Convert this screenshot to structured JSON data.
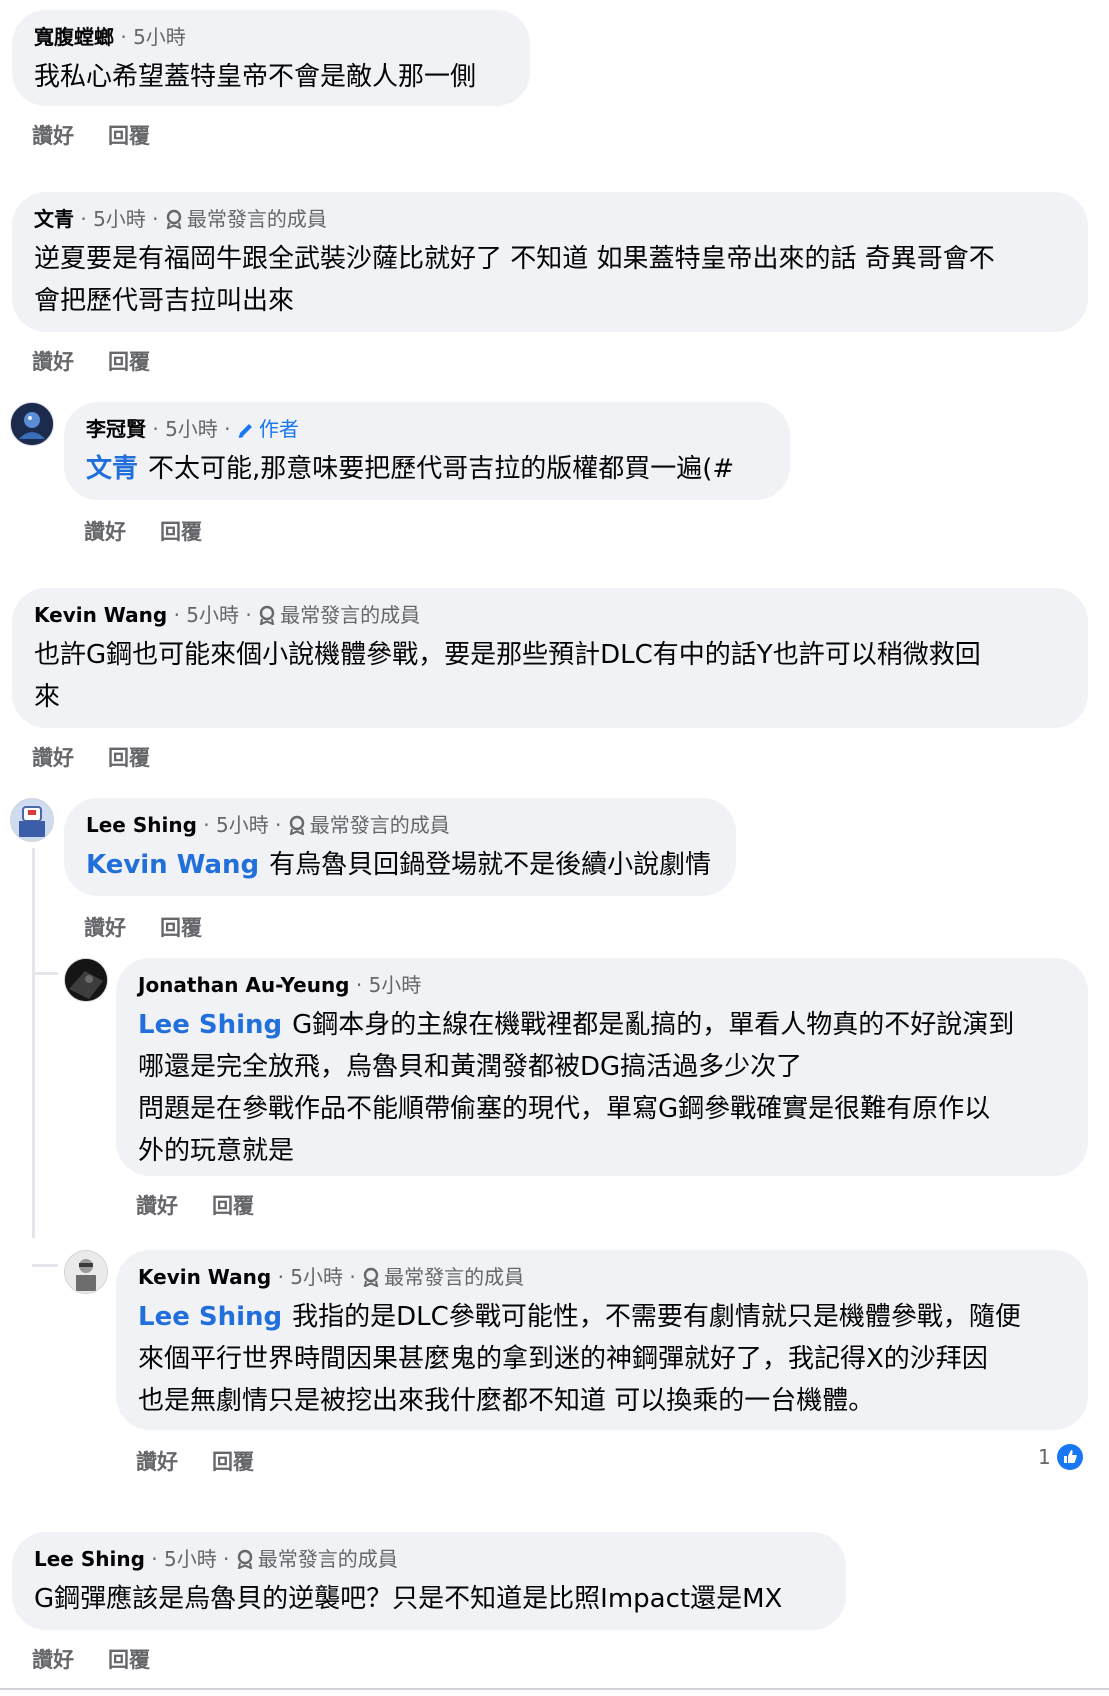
{
  "comments": [
    {
      "author": "寬腹螳螂",
      "time": "5小時",
      "badge": "",
      "mention": "",
      "text": "我私心希望蓋特皇帝不會是敵人那一側",
      "like": "讚好",
      "reply": "回覆"
    },
    {
      "author": "文青",
      "time": "5小時",
      "badge": "最常發言的成員",
      "mention": "",
      "text": "逆夏要是有福岡牛跟全武裝沙薩比就好了 不知道 如果蓋特皇帝出來的話 奇異哥會不\n會把歷代哥吉拉叫出來",
      "like": "讚好",
      "reply": "回覆"
    },
    {
      "author": "李冠賢",
      "time": "5小時",
      "badge": "作者",
      "mention": "文青",
      "text": "不太可能,那意味要把歷代哥吉拉的版權都買一遍(#",
      "like": "讚好",
      "reply": "回覆"
    },
    {
      "author": "Kevin Wang",
      "time": "5小時",
      "badge": "最常發言的成員",
      "mention": "",
      "text": "也許G鋼也可能來個小說機體參戰，要是那些預計DLC有中的話Y也許可以稍微救回\n來",
      "like": "讚好",
      "reply": "回覆"
    },
    {
      "author": "Lee Shing",
      "time": "5小時",
      "badge": "最常發言的成員",
      "mention": "Kevin Wang",
      "text": "有烏魯貝回鍋登場就不是後續小說劇情",
      "like": "讚好",
      "reply": "回覆"
    },
    {
      "author": "Jonathan Au-Yeung",
      "time": "5小時",
      "badge": "",
      "mention": "Lee Shing",
      "text": "G鋼本身的主線在機戰裡都是亂搞的，單看人物真的不好說演到\n哪還是完全放飛，烏魯貝和黃潤發都被DG搞活過多少次了\n問題是在參戰作品不能順帶偷塞的現代，單寫G鋼參戰確實是很難有原作以\n外的玩意就是",
      "like": "讚好",
      "reply": "回覆"
    },
    {
      "author": "Kevin Wang",
      "time": "5小時",
      "badge": "最常發言的成員",
      "mention": "Lee Shing",
      "text": "我指的是DLC參戰可能性，不需要有劇情就只是機體參戰，隨便\n來個平行世界時間因果甚麼鬼的拿到迷的神鋼彈就好了，我記得X的沙拜因\n也是無劇情只是被挖出來我什麼都不知道 可以換乘的一台機體。",
      "like": "讚好",
      "reply": "回覆",
      "reaction_count": "1"
    },
    {
      "author": "Lee Shing",
      "time": "5小時",
      "badge": "最常發言的成員",
      "mention": "",
      "text": "G鋼彈應該是烏魯貝的逆襲吧？只是不知道是比照Impact還是MX",
      "like": "讚好",
      "reply": "回覆"
    }
  ],
  "colors": {
    "bubble": "#f0f2f5",
    "meta": "#65676b",
    "mention": "#216fdb",
    "like_blue": "#1877f2"
  },
  "icons": {
    "top_fan": "badge-icon",
    "author": "pencil-icon",
    "reaction": "thumbs-up-icon"
  }
}
